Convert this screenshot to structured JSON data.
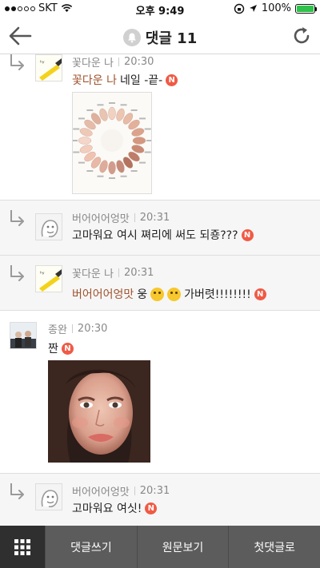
{
  "status_bar": {
    "carrier": "SKT",
    "time": "오후 9:49",
    "battery": "100%",
    "battery_level": 1.0,
    "battery_color": "#2ec24a"
  },
  "header": {
    "title": "댓글 11",
    "back_icon": "back-arrow-icon",
    "refresh_icon": "refresh-icon",
    "bell_icon": "bell-icon"
  },
  "comments": [
    {
      "author": "꽃다운 나",
      "time": "20:30",
      "mention": "꽃다운 나",
      "text": "네일 -끝-",
      "badge": "N",
      "image": "nail-color-wheel-image"
    },
    {
      "author": "버어어어엉맛",
      "time": "20:31",
      "text": "고마워요 여시 쪄리에 써도 되죵???",
      "badge": "N"
    },
    {
      "author": "꽃다운 나",
      "time": "20:31",
      "mention": "버어어어엉맛",
      "text_before": "웅",
      "text_after": "가버렷!!!!!!!!",
      "badge": "N"
    },
    {
      "author": "종완",
      "time": "20:30",
      "text": "짠",
      "badge": "N",
      "image": "portrait-photo-image"
    },
    {
      "author": "버어어어엉맛",
      "time": "20:31",
      "text": "고마워요 여싯!",
      "badge": "N"
    }
  ],
  "bottom_bar": {
    "menu_icon": "grid-menu-icon",
    "tabs": [
      "댓글쓰기",
      "원문보기",
      "첫댓글로"
    ]
  }
}
